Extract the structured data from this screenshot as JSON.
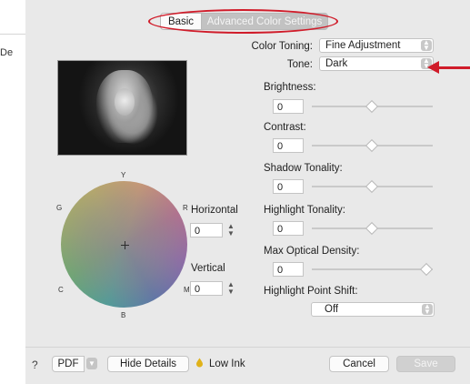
{
  "background_window": {
    "cut_label": "De"
  },
  "tabs": [
    {
      "label": "Basic",
      "selected": false
    },
    {
      "label": "Advanced Color Settings",
      "selected": true
    }
  ],
  "color_toning": {
    "label": "Color Toning:",
    "value": "Fine Adjustment"
  },
  "tone": {
    "label": "Tone:",
    "value": "Dark"
  },
  "sliders": [
    {
      "label": "Brightness:",
      "value": "0",
      "level": 0.5
    },
    {
      "label": "Contrast:",
      "value": "0",
      "level": 0.5
    },
    {
      "label": "Shadow Tonality:",
      "value": "0",
      "level": 0.5
    },
    {
      "label": "Highlight Tonality:",
      "value": "0",
      "level": 0.5
    },
    {
      "label": "Max Optical Density:",
      "value": "0",
      "level": 1.0
    }
  ],
  "highlight_point_shift": {
    "label": "Highlight Point Shift:",
    "value": "Off"
  },
  "color_wheel": {
    "top": "Y",
    "left": "G",
    "right": "R",
    "bottom_left": "C",
    "bottom_right": "M",
    "bottom": "B"
  },
  "horizontal": {
    "label": "Horizontal",
    "value": "0"
  },
  "vertical": {
    "label": "Vertical",
    "value": "0"
  },
  "footer": {
    "help": "?",
    "pdf": "PDF",
    "hide_details": "Hide Details",
    "low_ink": "Low Ink",
    "cancel": "Cancel",
    "save": "Save"
  },
  "icons": {
    "stepper": "stepper-icon",
    "popup": "popup-arrows-icon",
    "ink": "ink-warning-icon"
  },
  "colors": {
    "annotation": "#d01c2a",
    "dialog_bg": "#e9e9e9",
    "selected_tab": "#c2c2c2"
  }
}
